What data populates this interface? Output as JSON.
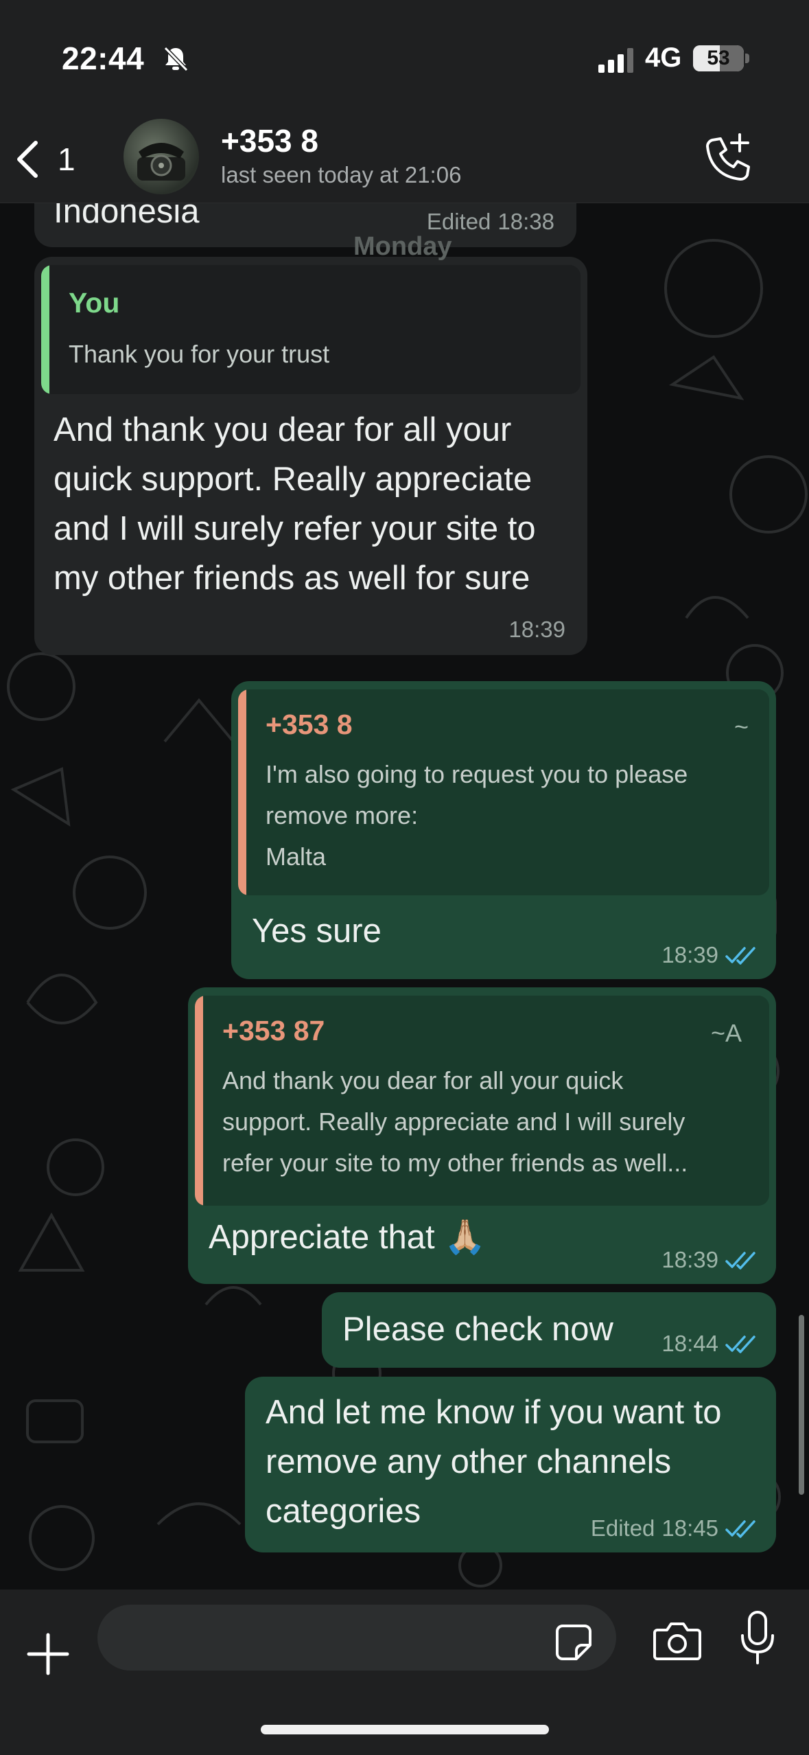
{
  "status_bar": {
    "time": "22:44",
    "network": "4G",
    "battery": "53",
    "battery_level": 0.53,
    "bell_icon": "bell-slash-icon",
    "signal_icon": "signal-bars-icon"
  },
  "header": {
    "back_icon": "chevron-left-icon",
    "unread_count": "1",
    "contact_name": "+353 8",
    "last_seen": "last seen today at 21:06",
    "call_icon": "phone-plus-icon"
  },
  "day_divider": "Monday",
  "messages": [
    {
      "direction": "in",
      "text": "Indonesia",
      "edited": "Edited",
      "time": "18:38"
    },
    {
      "direction": "in",
      "quote": {
        "author": "You",
        "text": "Thank you for your trust"
      },
      "lines": [
        "And thank you dear for all your",
        "quick support. Really appreciate",
        "and I will surely refer your site to",
        "my other friends as well for sure"
      ],
      "time": "18:39"
    },
    {
      "direction": "out",
      "quote": {
        "author": "+353 8",
        "tag": "~",
        "lines": [
          "I'm also going to request you to please",
          "remove more:",
          "Malta"
        ]
      },
      "text": "Yes sure",
      "time": "18:39"
    },
    {
      "direction": "out",
      "quote": {
        "author": "+353 87",
        "tag": "~A",
        "lines": [
          "And thank you dear for all your quick",
          "support. Really appreciate and I will surely",
          "refer your site to my other friends as well..."
        ]
      },
      "text": "Appreciate that 🙏🏼",
      "time": "18:39"
    },
    {
      "direction": "out",
      "text": "Please check now",
      "time": "18:44"
    },
    {
      "direction": "out",
      "lines": [
        "And let me know if you want to",
        "remove any other channels",
        "categories"
      ],
      "edited": "Edited",
      "time": "18:45"
    }
  ],
  "footer": {
    "input_placeholder": "",
    "plus_icon": "plus-icon",
    "sticker_icon": "sticker-icon",
    "camera_icon": "camera-icon",
    "mic_icon": "microphone-icon"
  },
  "colors": {
    "incoming_bubble": "#232526",
    "outgoing_bubble": "#1f4a37",
    "you_quote_accent": "#7ed98b",
    "contact_quote_accent": "#e8967a",
    "read_ticks": "#53bdeb"
  }
}
